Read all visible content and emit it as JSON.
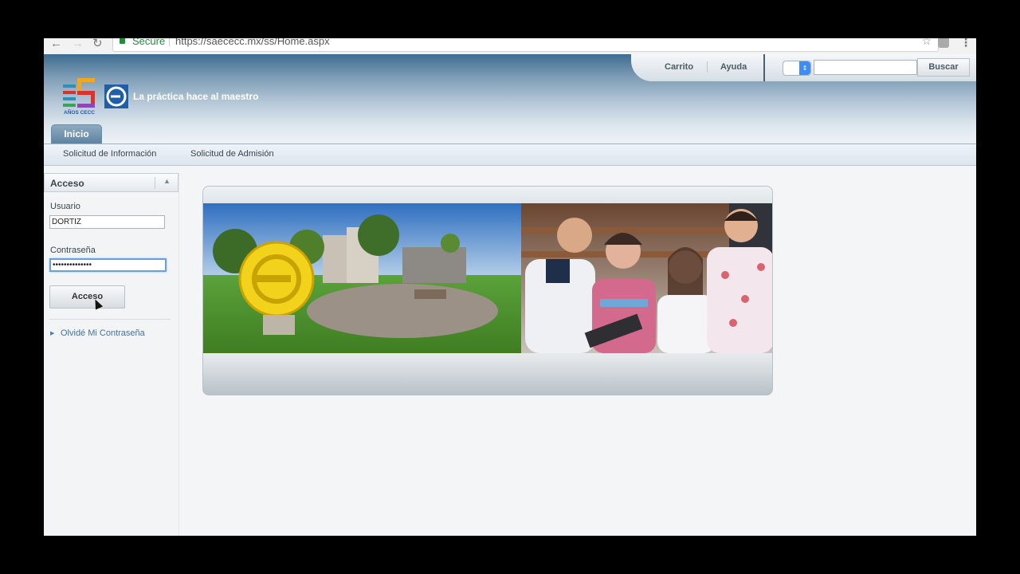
{
  "browser": {
    "secure_label": "Secure",
    "url": "https://saececc.mx/ss/Home.aspx"
  },
  "header": {
    "tagline": "La práctica hace al maestro",
    "logo_text": "AÑOS CECC",
    "topbar": {
      "cart_label": "Carrito",
      "help_label": "Ayuda",
      "search_placeholder": "",
      "search_button": "Buscar"
    },
    "tabs": [
      {
        "label": "Inicio",
        "active": true
      }
    ]
  },
  "subnav": {
    "items": [
      {
        "label": "Solicitud de Información"
      },
      {
        "label": "Solicitud de Admisión"
      }
    ]
  },
  "login_panel": {
    "title": "Acceso",
    "username_label": "Usuario",
    "username_value": "DORTIZ",
    "password_label": "Contraseña",
    "password_value": "••••••••••••••",
    "submit_label": "Acceso",
    "forgot_label": "Olvidé Mi Contraseña"
  },
  "colors": {
    "header_dark": "#3e6c8f",
    "link_blue": "#3f73a6",
    "secure_green": "#1e8e3e",
    "logo_yellow": "#f2d21b"
  }
}
